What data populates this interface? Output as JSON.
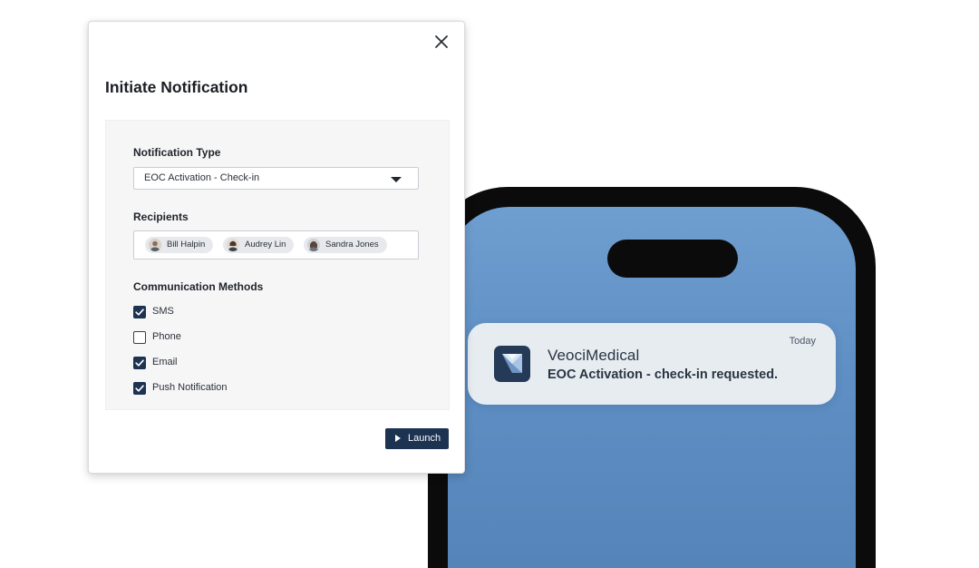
{
  "dialog": {
    "title": "Initiate Notification",
    "close_icon": "close-icon",
    "notification_type": {
      "label": "Notification Type",
      "selected": "EOC Activation - Check-in"
    },
    "recipients": {
      "label": "Recipients",
      "people": [
        {
          "name": "Bill Halpin"
        },
        {
          "name": "Audrey Lin"
        },
        {
          "name": "Sandra Jones"
        }
      ]
    },
    "communication_methods": {
      "label": "Communication Methods",
      "options": [
        {
          "label": "SMS",
          "checked": true
        },
        {
          "label": "Phone",
          "checked": false
        },
        {
          "label": "Email",
          "checked": true
        },
        {
          "label": "Push Notification",
          "checked": true
        }
      ]
    },
    "launch_label": "Launch"
  },
  "phone_notification": {
    "app_name": "VeociMedical",
    "message": "EOC Activation - check-in requested.",
    "time": "Today"
  },
  "colors": {
    "brand_navy": "#1c3351",
    "phone_screen": "#5f8fc4",
    "notification_card": "#eceff3"
  }
}
